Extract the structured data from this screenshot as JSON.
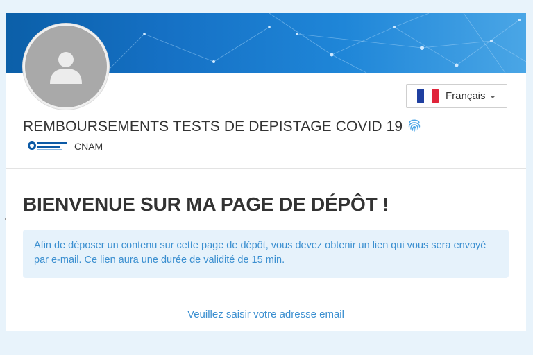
{
  "header": {
    "title": "REMBOURSEMENTS TESTS DE DEPISTAGE COVID 19",
    "organization": {
      "logo_text": "l'Assurance Maladie",
      "name": "CNAM"
    },
    "icons": {
      "avatar": "user-placeholder-icon",
      "title_badge": "fingerprint-icon"
    }
  },
  "language": {
    "selected": "Français",
    "flag": "france-flag-icon"
  },
  "main": {
    "welcome": "BIENVENUE SUR MA PAGE DE DÉPÔT !",
    "info": "Afin de déposer un contenu sur cette page de dépôt, vous devez obtenir un lien qui vous sera envoyé par e-mail. Ce lien aura une durée de validité de 15 min.",
    "email_placeholder": "Veuillez saisir votre adresse email"
  },
  "colors": {
    "accent": "#3b8fd0",
    "alert_bg": "#e6f2fb",
    "banner": "#1570c4",
    "page_bg": "#e8f3fb"
  }
}
